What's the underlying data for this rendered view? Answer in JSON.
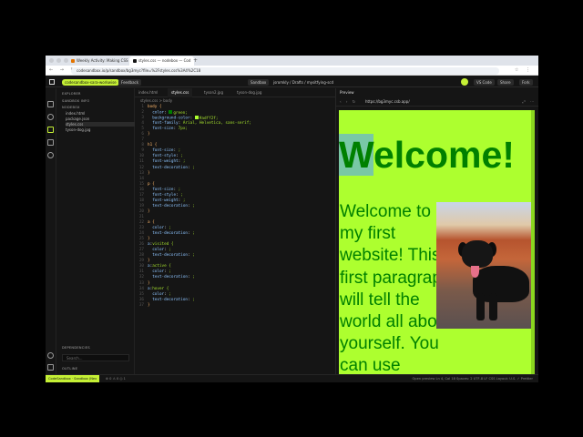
{
  "browser": {
    "tabs": [
      {
        "label": "Weekly Activity: Making CSS",
        "color": "#e37400",
        "active": false
      },
      {
        "label": "styles.css — nodebox — Cod",
        "color": "#151515",
        "active": true
      }
    ],
    "new_tab": "+",
    "url": "codesandbox.io/p/sandbox/bg3myc?file=%2Fstyles.css%3A4%2C18"
  },
  "csb": {
    "workspace": "codesandbox-sara-workwise",
    "feedback": "Feedback",
    "sandbox": "Sandbox",
    "breadcrumb": "jsromkly / Drafts / mysitfying-scd",
    "vscode": "VS Code",
    "share": "Share",
    "fork": "Fork"
  },
  "sidebar": {
    "title": "EXPLORER",
    "sandbox_info": "SANDBOX INFO",
    "folder": "NODEBOX",
    "files": [
      "index.html",
      "package.json",
      "styles.css",
      "tyson-dog.jpg"
    ],
    "selected_index": 2,
    "dependencies": "DEPENDENCIES",
    "search_placeholder": "Search...",
    "outline": "OUTLINE"
  },
  "editor": {
    "tabs": [
      "index.html",
      "styles.css",
      "tyson2.jpg",
      "tyson-dog.jpg"
    ],
    "active_tab": 1,
    "crumb": "styles.css > body",
    "lines": [
      "body {",
      "  color: green;",
      "  background-color: #adff2f;",
      "  font-family: Arial, Helvetica, sans-serif;",
      "  font-size: 7px;",
      "}",
      "",
      "h1 {",
      "  font-size: ;",
      "  font-style: ;",
      "  font-weight: ;",
      "  text-decoration: ;",
      "}",
      "",
      "p {",
      "  font-size: ;",
      "  font-style: ;",
      "  font-weight: ;",
      "  text-decoration: ;",
      "}",
      "",
      "a {",
      "  color: ;",
      "  text-decoration: ;",
      "}",
      "a:visited {",
      "  color: ;",
      "  text-decoration: ;",
      "}",
      "a:active {",
      "  color: ;",
      "  text-decoration: ;",
      "}",
      "a:hover {",
      "  color: ;",
      "  text-decoration: ;",
      "}"
    ]
  },
  "preview": {
    "tab": "Preview",
    "url": "https://bg3myc.csb.app/",
    "heading": "Welcome!",
    "paragraph": "Welcome to my first website! This first paragraph will tell the world all about yourself. You can use"
  },
  "status": {
    "left_badge": "CodeSandbox · Sandbox (Nex",
    "left_info": "⊗ 0  ⚠ 0   ◎ 1",
    "right_info": "Open preview   Ln 4, Col 18   Spaces: 2   UTF-8   LF   CSS   Layout: U.S.   ✓ Prettier"
  },
  "colors": {
    "accent": "#c5f035",
    "page_bg": "#adff2f",
    "page_text": "green"
  }
}
